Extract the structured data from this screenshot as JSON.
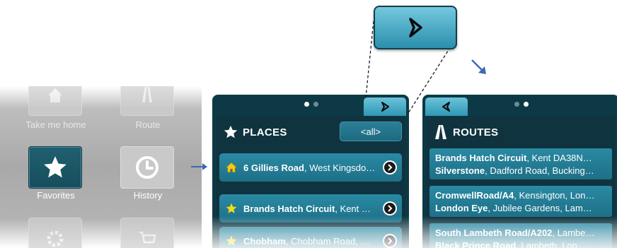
{
  "menu": {
    "take_me_home_label": "Take me home",
    "route_label": "Route",
    "favorites_label": "Favorites",
    "history_label": "History"
  },
  "places_panel": {
    "title": "PLACES",
    "filter_button": "<all>",
    "items": [
      {
        "name": "6 Gillies Road",
        "detail": ", West Kingsdo…",
        "icon": "home-icon"
      },
      {
        "name": "Brands Hatch Circuit",
        "detail": ", Kent …",
        "icon": "star-icon"
      },
      {
        "name": "Chobham",
        "detail": ", Chobham Road, …",
        "icon": "star-icon"
      }
    ]
  },
  "routes_panel": {
    "title": "ROUTES",
    "items": [
      {
        "line1_name": "Brands Hatch Circuit",
        "line1_detail": ", Kent DA38N…",
        "line2_name": "Silverstone",
        "line2_detail": ", Dadford Road, Bucking…"
      },
      {
        "line1_name": "CromwellRoad/A4",
        "line1_detail": ", Kensington, Lon…",
        "line2_name": "London Eye",
        "line2_detail": ", Jubilee Gardens, Lam…"
      },
      {
        "line1_name": "South Lambeth Road/A202",
        "line1_detail": ", Lambe…",
        "line2_name": "Black Prince Road",
        "line2_detail": ", Lambeth, Lon…"
      }
    ]
  },
  "colors": {
    "panel_dark": "#0d3946",
    "row_teal": "#2a8aa4",
    "tab_light": "#6bc3da",
    "arrow_blue": "#3b6ab3"
  }
}
